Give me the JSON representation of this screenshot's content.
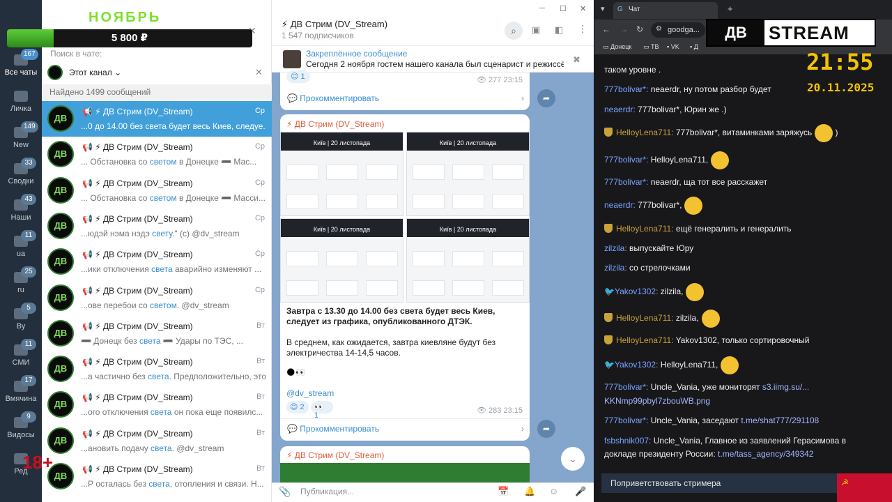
{
  "overlay": {
    "month": "НОЯБРЬ",
    "amount": "5 800 ₽",
    "progress_fraction": 0.19,
    "logo_left": "ДВ",
    "logo_right": "STREAM",
    "clock": "21:55",
    "date": "20.11.2025",
    "age": "18+"
  },
  "folders": [
    {
      "label": "Все чаты",
      "badge": "167"
    },
    {
      "label": "Личка",
      "badge": ""
    },
    {
      "label": "New",
      "badge": "149"
    },
    {
      "label": "Сводки",
      "badge": "33"
    },
    {
      "label": "Наши",
      "badge": "43"
    },
    {
      "label": "ua",
      "badge": "11"
    },
    {
      "label": "ru",
      "badge": "25"
    },
    {
      "label": "By",
      "badge": "5"
    },
    {
      "label": "СМИ",
      "badge": "11"
    },
    {
      "label": "Вмячина",
      "badge": "17"
    },
    {
      "label": "Видосы",
      "badge": "9"
    },
    {
      "label": "Ред",
      "badge": ""
    }
  ],
  "search": {
    "label": "Поиск в чате:",
    "filter": "Этот канал",
    "found": "Найдено 1499 сообщений"
  },
  "chats": [
    {
      "name": "📢 ⚡ ДВ Стрим (DV_Stream)",
      "time": "Ср",
      "pre": "...0 до 14.00 без света будет весь Киев, следуе...",
      "hl": "",
      "post": ""
    },
    {
      "name": "📢 ⚡ ДВ Стрим (DV_Stream)",
      "time": "Ср",
      "pre": "... Обстановка со ",
      "hl": "светом",
      "post": " в Донецке ➖ Мас..."
    },
    {
      "name": "📢 ⚡ ДВ Стрим (DV_Stream)",
      "time": "Ср",
      "pre": "... Обстановка со ",
      "hl": "светом",
      "post": " в Донецке ➖ Масси..."
    },
    {
      "name": "📢 ⚡ ДВ Стрим (DV_Stream)",
      "time": "Ср",
      "pre": "...юдэй нэма нэдэ ",
      "hl": "свету",
      "post": ".\" (с) @dv_stream"
    },
    {
      "name": "📢 ⚡ ДВ Стрим (DV_Stream)",
      "time": "Ср",
      "pre": "...ики отключения ",
      "hl": "света",
      "post": " аварийно изменяют ..."
    },
    {
      "name": "📢 ⚡ ДВ Стрим (DV_Stream)",
      "time": "Ср",
      "pre": "...ове перебои со ",
      "hl": "светом",
      "post": ". @dv_stream"
    },
    {
      "name": "📢 ⚡ ДВ Стрим (DV_Stream)",
      "time": "Вт",
      "pre": "➖ Донецк без ",
      "hl": "света",
      "post": " ➖ Удары по ТЭС, ..."
    },
    {
      "name": "📢 ⚡ ДВ Стрим (DV_Stream)",
      "time": "Вт",
      "pre": "...а частично без ",
      "hl": "света",
      "post": ". Предположительно, это ..."
    },
    {
      "name": "📢 ⚡ ДВ Стрим (DV_Stream)",
      "time": "Вт",
      "pre": "...ого отключения ",
      "hl": "света",
      "post": " он пока еще появилс..."
    },
    {
      "name": "📢 ⚡ ДВ Стрим (DV_Stream)",
      "time": "Вт",
      "pre": "...ановить подачу ",
      "hl": "света",
      "post": ". @dv_stream"
    },
    {
      "name": "📢 ⚡ ДВ Стрим (DV_Stream)",
      "time": "Вт",
      "pre": "...Р осталась без ",
      "hl": "света",
      "post": ", отопления и связи. Н..."
    }
  ],
  "header": {
    "title": "⚡ ДВ Стрим (DV_Stream)",
    "subs": "1 547 подписчиков",
    "pinned_title": "Закреплённое сообщение",
    "pinned_text": "Сегодня 2 ноября гостем нашего канала был сценарист и режиссёр..."
  },
  "post1": {
    "reaction": "1",
    "views": "277",
    "time": "23:15",
    "comment": "Прокомментировать"
  },
  "post2": {
    "author": "⚡ ДВ Стрим (DV_Stream)",
    "tile_title": "Київ | 20 листопада",
    "text1": "Завтра с 13.30 до 14.00 без света будет весь Киев, следует из графика, опубликованного ДТЭК.",
    "text2": "В среднем, как ожидается, завтра киевляне будут без электричества 14-14,5 часов.",
    "link": "@dv_stream",
    "r1": "2",
    "r2": "1",
    "views": "283",
    "time": "23:15",
    "comment": "Прокомментировать"
  },
  "post3": {
    "author": "⚡ ДВ Стрим (DV_Stream)"
  },
  "compose": {
    "placeholder": "Публикация..."
  },
  "browser": {
    "tab": "Чат",
    "url": "goodga...",
    "bookmarks": [
      "Донецк",
      "ТВ",
      "VK",
      "Д"
    ]
  },
  "chat_lines": [
    {
      "u": "",
      "msg": "таком уровне ."
    },
    {
      "u": "777bolivar*:",
      "msg": " neaerdr, ну потом разбор будет"
    },
    {
      "u": "neaerdr:",
      "msg": " 777bolivar*, Юрин же .)"
    },
    {
      "u": "HelloyLena711:",
      "msg": " 777bolivar*, витаминками заряжусь"
    },
    {
      "u": "777bolivar*:",
      "msg": " HelloyLena711,"
    },
    {
      "u": "777bolivar*:",
      "msg": " neaerdr, ща тот все расскажет"
    },
    {
      "u": "neaerdr:",
      "msg": " 777bolivar*,"
    },
    {
      "u": "HelloyLena711:",
      "msg": " ещё генералить и генералить"
    },
    {
      "u": "zilzila:",
      "msg": " выпускайте Юру"
    },
    {
      "u": "zilzila:",
      "msg": " со стрелочками"
    },
    {
      "u": "Yakov1302:",
      "msg": " zilzila,"
    },
    {
      "u": "HelloyLena711:",
      "msg": " zilzila,"
    },
    {
      "u": "HelloyLena711:",
      "msg": " Yakov1302, только сортировочный"
    },
    {
      "u": "Yakov1302:",
      "msg": " HelloyLena711,"
    },
    {
      "u": "777bolivar*:",
      "msg": " Uncle_Vania, уже мониторят ",
      "link": "s3.iimg.su/..."
    },
    {
      "u": "",
      "msg": "",
      "link": "KKNmp99pbyl7zbouWB.png"
    },
    {
      "u": "777bolivar*:",
      "msg": " Uncle_Vania, заседают ",
      "link": "t.me/shat777/291108"
    },
    {
      "u": "fsbshnik007:",
      "msg": " Uncle_Vania, Главное из заявлений Герасимова в"
    },
    {
      "u": "",
      "msg": "докладе президенту России: ",
      "link": "t.me/tass_agency/349342"
    }
  ],
  "greet": "Поприветствовать стримера"
}
